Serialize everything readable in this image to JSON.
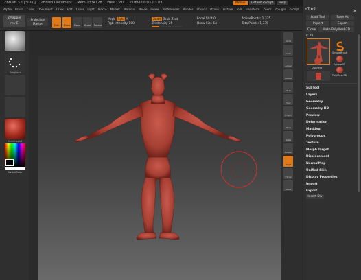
{
  "titlebar": {
    "app": "ZBrush 3.1 [3Dliu]",
    "doc": "ZBrush Document",
    "mem": "Mem:1334128",
    "free": "Free:1391",
    "ztime": "ZTime:00:01:03.03",
    "tags": [
      "Menus",
      "DefaultZScript",
      "Help"
    ]
  },
  "menubar": [
    "Alpha",
    "Brush",
    "Color",
    "Document",
    "Draw",
    "Edit",
    "Layer",
    "Light",
    "Macro",
    "Marker",
    "Material",
    "Movie",
    "Picker",
    "Preferences",
    "Render",
    "Stencil",
    "Stroke",
    "Texture",
    "Tool",
    "Transform",
    "Zoom",
    "Zplugin",
    "Zscript"
  ],
  "toolbar": {
    "zmapper": "ZMapper",
    "zmapper_sub": "rev-E",
    "projection": "Projection",
    "master": "Master",
    "modes": [
      "Edit",
      "Draw",
      "Move",
      "Scale",
      "Rotate"
    ],
    "mrgb": "Mrgb",
    "rgb": "Rgb",
    "m": "M",
    "zadd": "Zadd",
    "zsub": "Zsub",
    "zcut": "Zcut",
    "rgb_intensity_label": "Rgb Intensity",
    "rgb_intensity": "100",
    "z_intensity_label": "Z Intensity",
    "z_intensity": "25",
    "z_intensity_pct": 25,
    "focal_shift_label": "Focal Shift",
    "focal_shift": "0",
    "draw_size_label": "Draw Size",
    "draw_size": "64",
    "active_points_label": "ActivePoints:",
    "active_points": "1,335",
    "total_points_label": "TotalPoints:",
    "total_points": "1,335"
  },
  "leftshelf": {
    "items": [
      "Standard",
      "DragRect",
      "",
      "",
      "SkinShade4"
    ],
    "switch_color": "SwitchColor"
  },
  "rightstrip": [
    "Scroll",
    "Zoom",
    "Actual",
    "AAHalf",
    "Persp",
    "Floor",
    "L.Sym",
    "Move",
    "Scale",
    "Rotate",
    "PolyF",
    "Transp",
    "Ghost"
  ],
  "toolpanel": {
    "title": "Tool",
    "load": "Load Tool",
    "save": "Save As",
    "import": "Import",
    "export": "Export",
    "clone": "Clone",
    "make_polymesh": "Make PolyMesh3D",
    "size_label": "R: 48",
    "thumbs": [
      "Zsphere",
      "SimpleBrush",
      "Sphere3D",
      "PolyMesh3D"
    ],
    "menu": [
      "SubTool",
      "Layers",
      "Geometry",
      "Geometry HD",
      "Preview",
      "Deformation",
      "Masking",
      "Polygroups",
      "Texture",
      "Morph Target",
      "Displacement",
      "NormalMap",
      "Unified Skin",
      "Display Properties",
      "Import",
      "Export"
    ],
    "insert": "Insert Div"
  },
  "colors": {
    "accent": "#e07a18",
    "model": "#b8463a"
  },
  "icons": {
    "close": "close-icon"
  }
}
